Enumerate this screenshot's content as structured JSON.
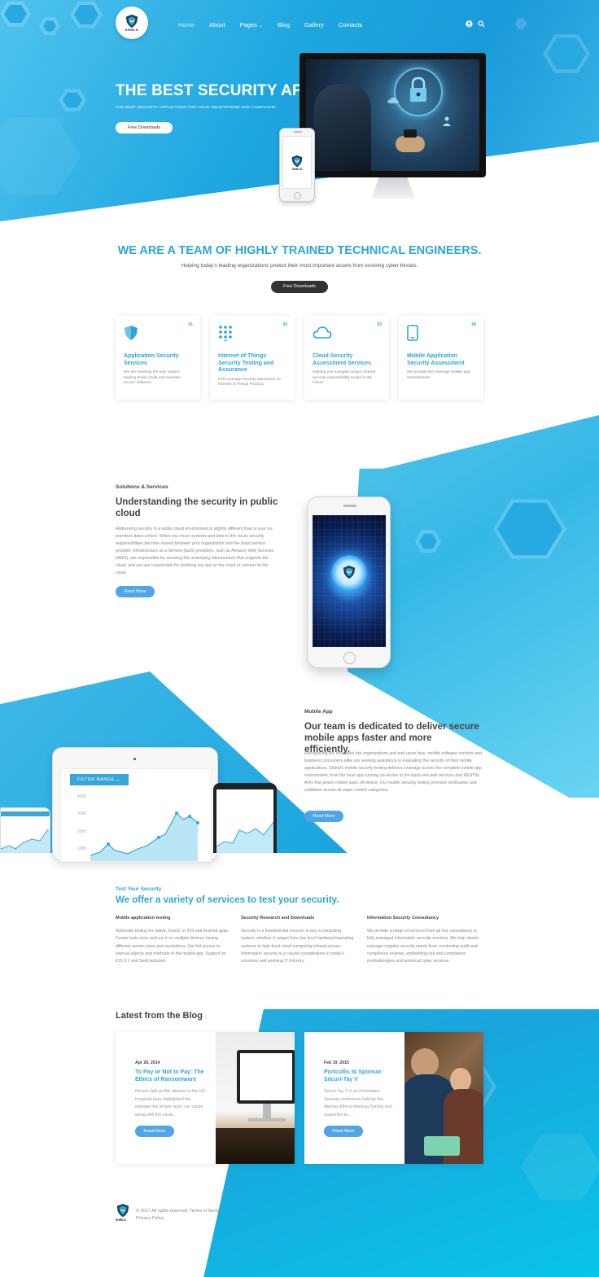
{
  "brand": {
    "logo_text": "SHIELD"
  },
  "nav": {
    "items": [
      "Home",
      "About",
      "Pages",
      "Blog",
      "Gallery",
      "Contacts"
    ],
    "pages_caret": "⌄"
  },
  "hero": {
    "title": "THE BEST SECURITY APP",
    "subtitle": "THE BEST SECURITY APPLICATION FOR YOUR SMARTPHONE AND COMPUTER!",
    "button": "Free Downloads"
  },
  "team": {
    "title": "WE ARE A TEAM OF HIGHLY TRAINED TECHNICAL ENGINEERS.",
    "subtitle": "Helping today's leading organizations protect their most important assets from evolving cyber threats.",
    "button": "Free Downloads"
  },
  "cards": [
    {
      "num": "01",
      "icon": "shield-icon",
      "title": "Application Security Services",
      "text": "We are evolving the way today's leading teams build and maintain secure software."
    },
    {
      "num": "02",
      "icon": "dots-grid-icon",
      "title": "Internet of Things Security Testing and Assurance",
      "text": "Full coverage security assurance for Internet of Things Product."
    },
    {
      "num": "03",
      "icon": "cloud-icon",
      "title": "Cloud Security Assessment Services",
      "text": "Helping you navigate today's shared security responsibility model in the Cloud."
    },
    {
      "num": "04",
      "icon": "mobile-icon",
      "title": "Mobile Application Security Assessment",
      "text": "We provide full coverage mobile app assessments."
    }
  ],
  "solutions": {
    "eyebrow": "Solutions & Services",
    "title": "Understanding the security in public cloud",
    "text": "Addressing security in a public cloud environment is slightly different than in your on-premises data centers. When you move systems and data to the cloud, security responsibilities become shared between your organization and the cloud service provider. Infrastructure as a Service (IaaS) providers, such as Amazon Web Services (AWS), are responsible for securing the underlying infrastructure that supports the cloud, and you are responsible for anything you put on the cloud or connect to the cloud.",
    "button": "Read More"
  },
  "mobile": {
    "eyebrow": "Mobile App",
    "title": "Our team is dedicated to deliver secure mobile apps faster and more efficiently.",
    "text": "Recognizing the increased risk organizations and end-users face, mobile software vendors and business consumers alike are seeking assistance in evaluating the security of their mobile applications. Shield's mobile security testing delivers coverage across the complete mobile app environment, from the local app running on-device to the back-end web services and RESTful APIs that power mobile apps off-device. Our mobile security testing provides verification and validation across all major control categories.",
    "button": "Read More",
    "tablet": {
      "filter_label": "FILTER RANGE",
      "y_ticks": [
        "4000",
        "3000",
        "2000",
        "1000"
      ]
    }
  },
  "test": {
    "eyebrow": "Test Your Security",
    "title": "We offer a variety of services to test your security.",
    "columns": [
      {
        "title": "Mobile application testing",
        "text": "Automate testing for native, hybrid, or iOS and Android apps. Create tests once and run it on multiple devices having different screen sizes and resolutions. Get full access to internal objects and methods of the mobile app. Support for iOS 9.1 and Swift included."
      },
      {
        "title": "Security Research and Downloads",
        "text": "Security is a fundamental concern in any a computing system, whether it ranges from low level hardware/operating systems to high-level cloud computing infrastructures. Information security is a crucial consideration in today's uncertain and evolving IT industry."
      },
      {
        "title": "Information Security Consultancy",
        "text": "We provide a range of services from ad hoc consultancy to fully managed information security services. We help clients manage complex security needs from conducting audit and compliance reviews, embedding risk and compliance methodologies and technical cyber services."
      }
    ]
  },
  "blog": {
    "title": "Latest from the Blog",
    "posts": [
      {
        "date": "Apr 26, 2014",
        "title": "To Pay or Not to Pay: The Ethics of Ransomware",
        "text": "Recent high-profile attacks on the US hospitals have highlighted the damage this simple tactic can cause, along with the moral...",
        "button": "Read More"
      },
      {
        "date": "Feb 19, 2015",
        "title": "Portcullis to Sponsor Securi-Tay V",
        "text": "Securi-Tay V is an information Security conference held by the Abertay Ethical Hacking Society and supported by ...",
        "button": "Read More"
      }
    ]
  },
  "footer": {
    "copyright": "© 2017 All rights reserved. Terms of Service",
    "privacy": "Privacy Policy"
  },
  "colors": {
    "accent": "#2ea5d8",
    "button_blue": "#4fa5e8",
    "dark_button": "#333333"
  }
}
